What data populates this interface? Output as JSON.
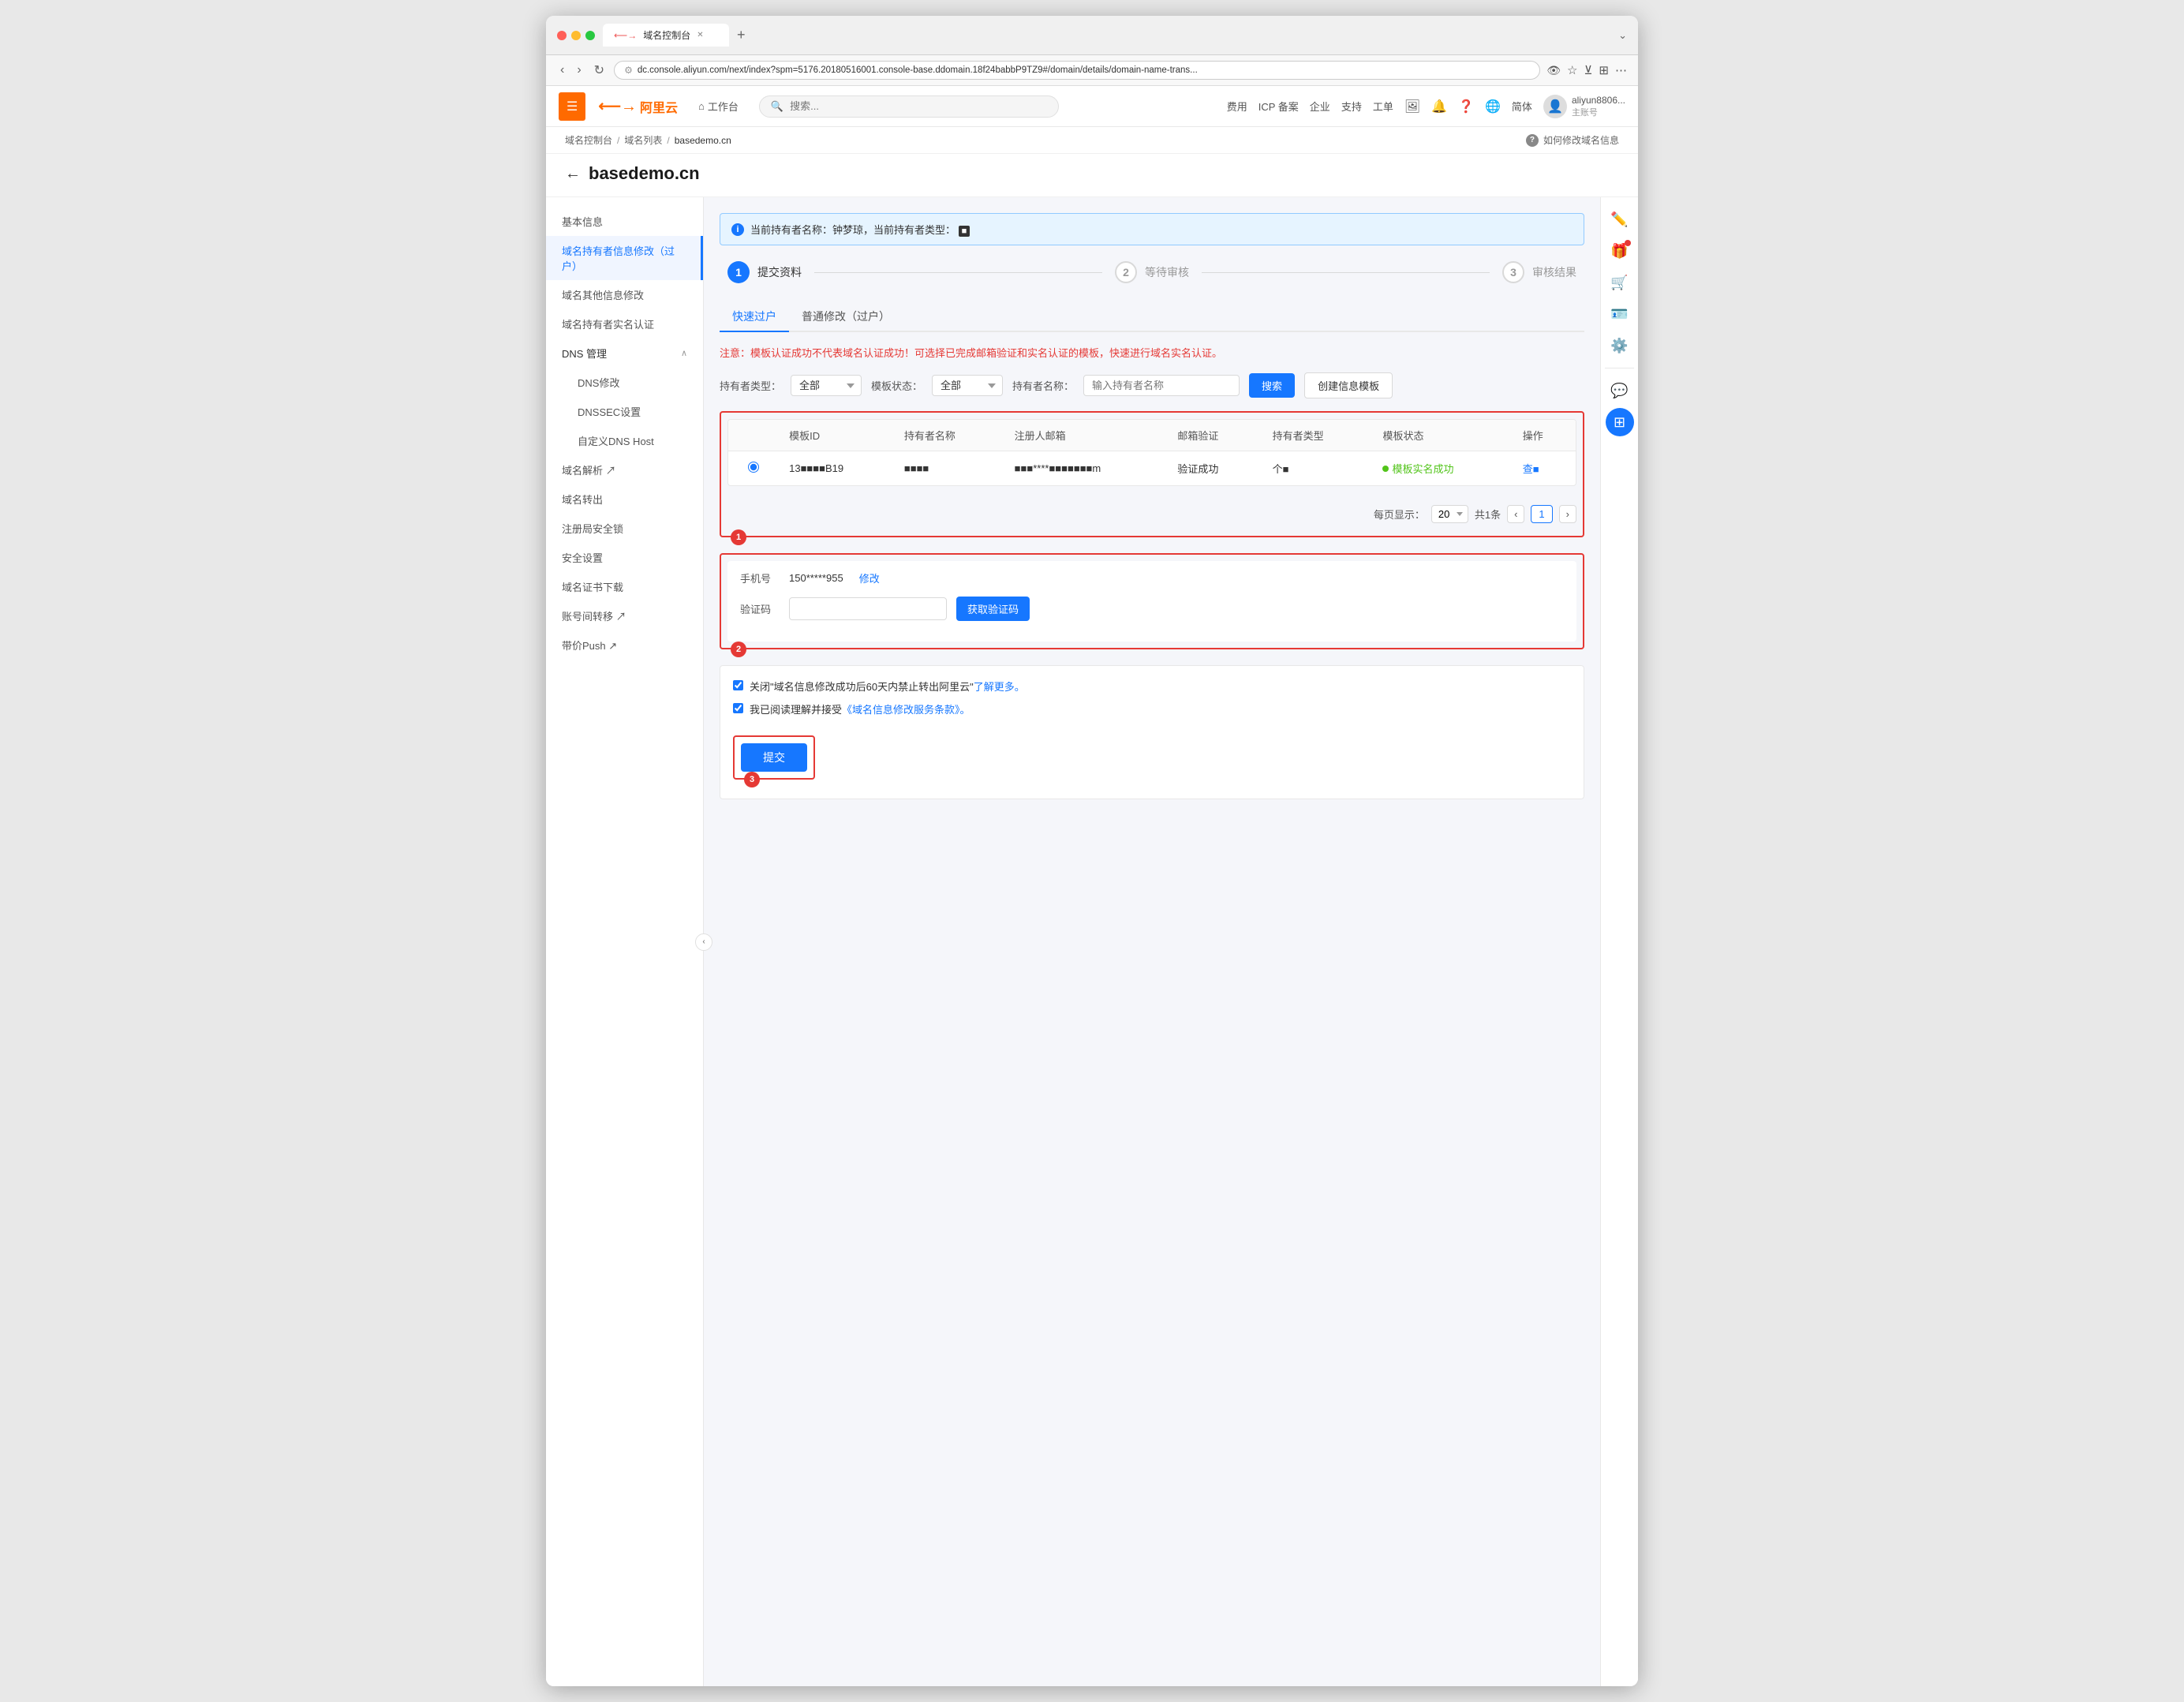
{
  "browser": {
    "tab_label": "域名控制台",
    "tab_icon": "⟵→",
    "url": "dc.console.aliyun.com/next/index?spm=5176.20180516001.console-base.ddomain.18f24babbP9TZ9#/domain/details/domain-name-trans...",
    "add_tab": "+",
    "chevron": "⌄"
  },
  "nav": {
    "hamburger": "☰",
    "logo": "⟵→",
    "logo_text": "阿里云",
    "workbench_icon": "⌂",
    "workbench_label": "工作台",
    "search_placeholder": "搜索...",
    "items": [
      "费用",
      "ICP 备案",
      "企业",
      "支持",
      "工单"
    ],
    "icons": [
      "image",
      "bell",
      "question",
      "globe"
    ],
    "lang": "简体",
    "username": "aliyun8806...",
    "user_type": "主账号"
  },
  "breadcrumb": {
    "items": [
      "域名控制台",
      "域名列表",
      "basedemo.cn"
    ],
    "help_text": "如何修改域名信息"
  },
  "page": {
    "back_arrow": "←",
    "title": "basedemo.cn"
  },
  "sidebar": {
    "items": [
      {
        "label": "基本信息",
        "active": false
      },
      {
        "label": "域名持有者信息修改（过户）",
        "active": true
      },
      {
        "label": "域名其他信息修改",
        "active": false
      },
      {
        "label": "域名持有者实名认证",
        "active": false
      },
      {
        "label": "DNS 管理",
        "active": false,
        "expandable": true,
        "expanded": true
      },
      {
        "label": "DNS修改",
        "active": false,
        "sub": true
      },
      {
        "label": "DNSSEC设置",
        "active": false,
        "sub": true
      },
      {
        "label": "自定义DNS Host",
        "active": false,
        "sub": true
      },
      {
        "label": "域名解析 ↗",
        "active": false,
        "external": true
      },
      {
        "label": "域名转出",
        "active": false
      },
      {
        "label": "注册局安全锁",
        "active": false
      },
      {
        "label": "安全设置",
        "active": false
      },
      {
        "label": "域名证书下载",
        "active": false
      },
      {
        "label": "账号间转移 ↗",
        "active": false,
        "external": true
      },
      {
        "label": "带价Push ↗",
        "active": false,
        "external": true
      }
    ]
  },
  "info_banner": {
    "text": "当前持有者名称：钟梦琼，当前持有者类型：",
    "highlight": "■"
  },
  "steps": [
    {
      "num": "1",
      "label": "提交资料",
      "active": true
    },
    {
      "num": "2",
      "label": "等待审核",
      "active": false
    },
    {
      "num": "3",
      "label": "审核结果",
      "active": false
    }
  ],
  "tabs": [
    {
      "label": "快速过户",
      "active": true
    },
    {
      "label": "普通修改（过户）",
      "active": false
    }
  ],
  "warning": {
    "text": "注意：模板认证成功不代表域名认证成功！可选择已完成邮箱验证和实名认证的模板，快速进行域名实名认证。"
  },
  "filter": {
    "holder_type_label": "持有者类型：",
    "holder_type_value": "全部",
    "template_status_label": "模板状态：",
    "template_status_value": "全部",
    "holder_name_label": "持有者名称：",
    "holder_name_placeholder": "输入持有者名称",
    "search_btn": "搜索",
    "create_btn": "创建信息模板"
  },
  "table": {
    "columns": [
      "模板ID",
      "持有者名称",
      "注册人邮箱",
      "邮箱验证",
      "持有者类型",
      "模板状态",
      "操作"
    ],
    "rows": [
      {
        "selected": true,
        "template_id": "13■■■■B19",
        "holder_name": "■■■■",
        "email": "■■■****■■■■■■■m",
        "email_verify": "验证成功",
        "holder_type": "个■",
        "template_status": "模板实名成功",
        "action": "查■"
      }
    ]
  },
  "pagination": {
    "per_page_label": "每页显示：",
    "per_page_value": "20",
    "total_label": "共1条",
    "prev": "‹",
    "next": "›",
    "current_page": "1"
  },
  "form": {
    "phone_label": "手机号",
    "phone_value": "150*****955",
    "modify_link": "修改",
    "verify_label": "验证码",
    "verify_placeholder": "",
    "get_code_btn": "获取验证码"
  },
  "checkboxes": [
    {
      "checked": true,
      "text": "关闭\"域名信息修改成功后60天内禁止转出阿里云\"",
      "link_text": "了解更多。",
      "link_href": "#"
    },
    {
      "checked": true,
      "text": "我已阅读理解并接受",
      "link_text": "《域名信息修改服务条款》。",
      "link_href": "#"
    }
  ],
  "submit": {
    "btn_label": "提交"
  },
  "right_panel": {
    "icons": [
      "pencil",
      "gift",
      "cart",
      "id-card",
      "gear",
      "divider",
      "chat",
      "grid"
    ]
  },
  "step_badges": {
    "badge1": "1",
    "badge2": "2",
    "badge3": "3"
  }
}
